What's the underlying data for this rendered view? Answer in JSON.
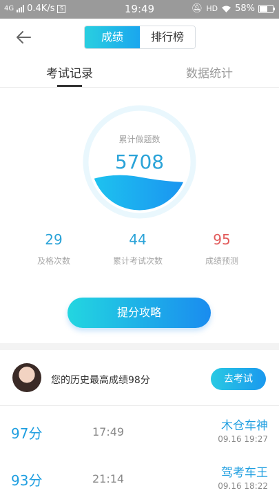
{
  "status": {
    "network": "4G",
    "speed": "0.4K/s",
    "time": "19:49",
    "hd": "HD",
    "battery": "58%"
  },
  "header": {
    "seg_active": "成绩",
    "seg_inactive": "排行榜"
  },
  "tabs": {
    "active": "考试记录",
    "inactive": "数据统计"
  },
  "gauge": {
    "label": "累计做题数",
    "value": "5708",
    "fill_fraction": 0.33
  },
  "stats": [
    {
      "num": "29",
      "label": "及格次数",
      "color": "#2aa3d8"
    },
    {
      "num": "44",
      "label": "累计考试次数",
      "color": "#2aa3d8"
    },
    {
      "num": "95",
      "label": "成绩预测",
      "color": "#e25b5b"
    }
  ],
  "cta": "提分攻略",
  "best": {
    "text": "您的历史最高成绩98分",
    "button": "去考试"
  },
  "records": [
    {
      "score": "97分",
      "duration": "17:49",
      "nickname": "木仓车神",
      "date": "09.16  19:27"
    },
    {
      "score": "93分",
      "duration": "21:14",
      "nickname": "驾考车王",
      "date": "09.16  18:22"
    }
  ],
  "colors": {
    "accent": "#1e9ee0",
    "accent_light": "#e9f7fd",
    "warn": "#e25b5b"
  }
}
